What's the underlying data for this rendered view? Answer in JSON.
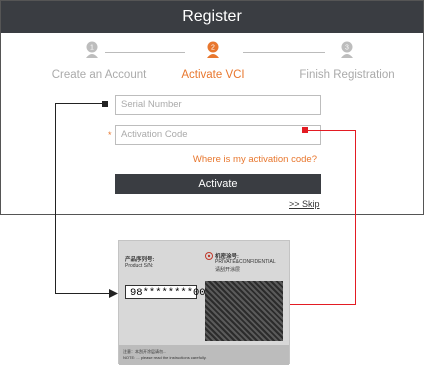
{
  "window": {
    "title": "Register"
  },
  "steps": [
    {
      "number": "1",
      "label": "Create an Account",
      "state": "done"
    },
    {
      "number": "2",
      "label": "Activate VCI",
      "state": "active"
    },
    {
      "number": "3",
      "label": "Finish Registration",
      "state": "pending"
    }
  ],
  "form": {
    "serial_placeholder": "Serial Number",
    "activation_placeholder": "Activation Code",
    "required_mark": "*",
    "help_link": "Where is my activation code?",
    "activate_button": "Activate",
    "skip_link": ">> Skip"
  },
  "card": {
    "product_label_cn": "产品序列号:",
    "product_label_en": "Product S/N:",
    "serial_value": "98********00",
    "confidential_cn": "机密涂号:",
    "confidential_en": "PRIVATE&CONFIDENTIAL",
    "confidential_sub": "请刮开涂层",
    "footer_note": "注意：本刮开涂层请勿...",
    "footer_note2": "NOTE: ... please read the instructions carefully."
  },
  "colors": {
    "accent": "#e8772e",
    "dark": "#3a3d42",
    "red_wire": "#e31b23"
  }
}
